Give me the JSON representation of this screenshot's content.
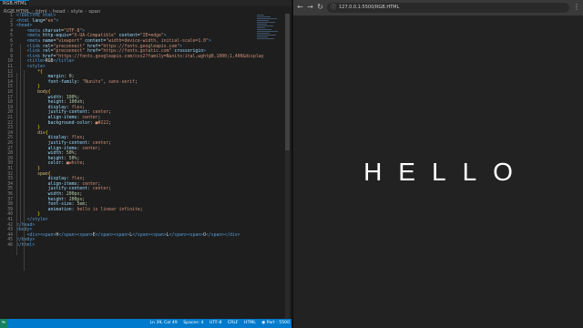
{
  "editor": {
    "tab_label": "RGB.HTML",
    "breadcrumb": [
      "RGB.HTML",
      "html",
      "head",
      "style",
      "span"
    ],
    "lines": [
      {
        "n": "1",
        "segs": [
          [
            "tag",
            "<!DOCTYPE html>"
          ]
        ]
      },
      {
        "n": "2",
        "segs": [
          [
            "tag",
            "<html "
          ],
          [
            "attr",
            "lang"
          ],
          [
            "txt",
            "="
          ],
          [
            "str",
            "\"en\""
          ],
          [
            "tag",
            ">"
          ]
        ]
      },
      {
        "n": "3",
        "segs": [
          [
            "tag",
            "<head>"
          ]
        ]
      },
      {
        "n": "4",
        "segs": [
          [
            "tag",
            "    <meta "
          ],
          [
            "attr",
            "charset"
          ],
          [
            "txt",
            "="
          ],
          [
            "str",
            "\"UTF-8\""
          ],
          [
            "tag",
            ">"
          ]
        ]
      },
      {
        "n": "5",
        "segs": [
          [
            "tag",
            "    <meta "
          ],
          [
            "attr",
            "http-equiv"
          ],
          [
            "txt",
            "="
          ],
          [
            "str",
            "\"X-UA-Compatible\""
          ],
          [
            "attr",
            " content"
          ],
          [
            "txt",
            "="
          ],
          [
            "str",
            "\"IE=edge\""
          ],
          [
            "tag",
            ">"
          ]
        ]
      },
      {
        "n": "6",
        "segs": [
          [
            "tag",
            "    <meta "
          ],
          [
            "attr",
            "name"
          ],
          [
            "txt",
            "="
          ],
          [
            "str",
            "\"viewport\""
          ],
          [
            "attr",
            " content"
          ],
          [
            "txt",
            "="
          ],
          [
            "str",
            "\"width=device-width, initial-scale=1.0\""
          ],
          [
            "tag",
            ">"
          ]
        ]
      },
      {
        "n": "7",
        "segs": [
          [
            "tag",
            "    <link "
          ],
          [
            "attr",
            "rel"
          ],
          [
            "txt",
            "="
          ],
          [
            "str",
            "\"preconnect\""
          ],
          [
            "attr",
            " href"
          ],
          [
            "txt",
            "="
          ],
          [
            "str",
            "\"https://fonts.googleapis.com\""
          ],
          [
            "tag",
            ">"
          ]
        ]
      },
      {
        "n": "8",
        "segs": [
          [
            "tag",
            "    <link "
          ],
          [
            "attr",
            "rel"
          ],
          [
            "txt",
            "="
          ],
          [
            "str",
            "\"preconnect\""
          ],
          [
            "attr",
            " href"
          ],
          [
            "txt",
            "="
          ],
          [
            "str",
            "\"https://fonts.gstatic.com\""
          ],
          [
            "attr",
            " crossorigin"
          ],
          [
            "tag",
            ">"
          ]
        ]
      },
      {
        "n": "9",
        "segs": [
          [
            "tag",
            "    <link "
          ],
          [
            "attr",
            "href"
          ],
          [
            "txt",
            "="
          ],
          [
            "str",
            "\"https://fonts.googleapis.com/css2?family=Nunito:ital,wght@0,1000;1,400&display"
          ]
        ]
      },
      {
        "n": "10",
        "segs": [
          [
            "tag",
            "    <title>"
          ],
          [
            "txt",
            "RGB"
          ],
          [
            "tag",
            "</title>"
          ]
        ]
      },
      {
        "n": "11",
        "segs": [
          [
            "tag",
            "    <style>"
          ]
        ]
      },
      {
        "n": "12",
        "segs": [
          [
            "sel",
            "        *"
          ],
          [
            "brk",
            "{"
          ]
        ]
      },
      {
        "n": "13",
        "segs": [
          [
            "prop",
            "            margin"
          ],
          [
            "txt",
            ": "
          ],
          [
            "num",
            "0"
          ],
          [
            "txt",
            ";"
          ]
        ]
      },
      {
        "n": "14",
        "segs": [
          [
            "prop",
            "            font-family"
          ],
          [
            "txt",
            ": "
          ],
          [
            "val",
            "\"Nunito\""
          ],
          [
            "txt",
            ", "
          ],
          [
            "val",
            "sans-serif"
          ],
          [
            "txt",
            ";"
          ]
        ]
      },
      {
        "n": "15",
        "segs": [
          [
            "brk",
            "        }"
          ]
        ]
      },
      {
        "n": "16",
        "segs": [
          [
            "sel",
            "        body"
          ],
          [
            "brk",
            "{"
          ]
        ]
      },
      {
        "n": "17",
        "segs": [
          [
            "prop",
            "            width"
          ],
          [
            "txt",
            ": "
          ],
          [
            "num",
            "100%"
          ],
          [
            "txt",
            ";"
          ]
        ]
      },
      {
        "n": "18",
        "segs": [
          [
            "prop",
            "            height"
          ],
          [
            "txt",
            ": "
          ],
          [
            "num",
            "100vh"
          ],
          [
            "txt",
            ";"
          ]
        ]
      },
      {
        "n": "19",
        "segs": [
          [
            "prop",
            "            display"
          ],
          [
            "txt",
            ": "
          ],
          [
            "val",
            "flex"
          ],
          [
            "txt",
            ";"
          ]
        ]
      },
      {
        "n": "20",
        "segs": [
          [
            "prop",
            "            justify-content"
          ],
          [
            "txt",
            ": "
          ],
          [
            "val",
            "center"
          ],
          [
            "txt",
            ";"
          ]
        ]
      },
      {
        "n": "21",
        "segs": [
          [
            "prop",
            "            align-items"
          ],
          [
            "txt",
            ": "
          ],
          [
            "val",
            "center"
          ],
          [
            "txt",
            ";"
          ]
        ]
      },
      {
        "n": "22",
        "segs": [
          [
            "prop",
            "            background-color"
          ],
          [
            "txt",
            ": "
          ],
          [
            "val",
            "■#222"
          ],
          [
            "txt",
            ";"
          ]
        ]
      },
      {
        "n": "23",
        "segs": [
          [
            "brk",
            "        }"
          ]
        ]
      },
      {
        "n": "24",
        "segs": [
          [
            "sel",
            "        div"
          ],
          [
            "brk",
            "{"
          ]
        ]
      },
      {
        "n": "25",
        "segs": [
          [
            "prop",
            "            display"
          ],
          [
            "txt",
            ": "
          ],
          [
            "val",
            "flex"
          ],
          [
            "txt",
            ";"
          ]
        ]
      },
      {
        "n": "26",
        "segs": [
          [
            "prop",
            "            justify-content"
          ],
          [
            "txt",
            ": "
          ],
          [
            "val",
            "center"
          ],
          [
            "txt",
            ";"
          ]
        ]
      },
      {
        "n": "27",
        "segs": [
          [
            "prop",
            "            align-items"
          ],
          [
            "txt",
            ": "
          ],
          [
            "val",
            "center"
          ],
          [
            "txt",
            ";"
          ]
        ]
      },
      {
        "n": "28",
        "segs": [
          [
            "prop",
            "            width"
          ],
          [
            "txt",
            ": "
          ],
          [
            "num",
            "50%"
          ],
          [
            "txt",
            ";"
          ]
        ]
      },
      {
        "n": "29",
        "segs": [
          [
            "prop",
            "            height"
          ],
          [
            "txt",
            ": "
          ],
          [
            "num",
            "50%"
          ],
          [
            "txt",
            ";"
          ]
        ]
      },
      {
        "n": "30",
        "segs": [
          [
            "prop",
            "            color"
          ],
          [
            "txt",
            ": "
          ],
          [
            "val",
            "■white"
          ],
          [
            "txt",
            ";"
          ]
        ]
      },
      {
        "n": "31",
        "segs": [
          [
            "brk",
            "        }"
          ]
        ]
      },
      {
        "n": "32",
        "segs": [
          [
            "sel",
            "        span"
          ],
          [
            "brk",
            "{"
          ]
        ]
      },
      {
        "n": "33",
        "segs": [
          [
            "prop",
            "            display"
          ],
          [
            "txt",
            ": "
          ],
          [
            "val",
            "flex"
          ],
          [
            "txt",
            ";"
          ]
        ]
      },
      {
        "n": "34",
        "segs": [
          [
            "prop",
            "            align-items"
          ],
          [
            "txt",
            ": "
          ],
          [
            "val",
            "center"
          ],
          [
            "txt",
            ";"
          ]
        ]
      },
      {
        "n": "35",
        "segs": [
          [
            "prop",
            "            justify-content"
          ],
          [
            "txt",
            ": "
          ],
          [
            "val",
            "center"
          ],
          [
            "txt",
            ";"
          ]
        ]
      },
      {
        "n": "36",
        "segs": [
          [
            "prop",
            "            width"
          ],
          [
            "txt",
            ": "
          ],
          [
            "num",
            "200px"
          ],
          [
            "txt",
            ";"
          ]
        ]
      },
      {
        "n": "37",
        "segs": [
          [
            "prop",
            "            height"
          ],
          [
            "txt",
            ": "
          ],
          [
            "num",
            "200px"
          ],
          [
            "txt",
            ";"
          ]
        ]
      },
      {
        "n": "38",
        "segs": [
          [
            "prop",
            "            font-size"
          ],
          [
            "txt",
            ": "
          ],
          [
            "num",
            "5em"
          ],
          [
            "txt",
            ";"
          ]
        ]
      },
      {
        "n": "39",
        "segs": [
          [
            "prop",
            "            animation"
          ],
          [
            "txt",
            ": "
          ],
          [
            "val",
            "hello is linear infinite"
          ],
          [
            "txt",
            ";"
          ]
        ]
      },
      {
        "n": "40",
        "segs": [
          [
            "brk",
            "        }"
          ]
        ]
      },
      {
        "n": "41",
        "segs": [
          [
            "tag",
            "    </style>"
          ]
        ]
      },
      {
        "n": "42",
        "segs": [
          [
            "tag",
            "</head>"
          ]
        ]
      },
      {
        "n": "43",
        "segs": [
          [
            "tag",
            "<body>"
          ]
        ]
      },
      {
        "n": "44",
        "segs": [
          [
            "tag",
            "    <div><span>"
          ],
          [
            "txt",
            "H"
          ],
          [
            "tag",
            "</span><span>"
          ],
          [
            "txt",
            "E"
          ],
          [
            "tag",
            "</span><span>"
          ],
          [
            "txt",
            "L"
          ],
          [
            "tag",
            "</span><span>"
          ],
          [
            "txt",
            "L"
          ],
          [
            "tag",
            "</span><span>"
          ],
          [
            "txt",
            "O"
          ],
          [
            "tag",
            "</span></div>"
          ]
        ]
      },
      {
        "n": "45",
        "segs": [
          [
            "tag",
            "</body>"
          ]
        ]
      },
      {
        "n": "46",
        "segs": [
          [
            "tag",
            "</html>"
          ]
        ]
      }
    ],
    "status": {
      "position": "Ln 39, Col 49",
      "spaces": "Spaces: 4",
      "encoding": "UTF-8",
      "eol": "CRLF",
      "language": "HTML",
      "port": "◉ Port : 5500"
    }
  },
  "browser": {
    "url": "127.0.0.1:5500/RGB.HTML",
    "letters": [
      "H",
      "E",
      "L",
      "L",
      "O"
    ]
  },
  "colors": {
    "accent": "#007acc",
    "editor_bg": "#1e1e1e",
    "page_bg": "#222"
  }
}
